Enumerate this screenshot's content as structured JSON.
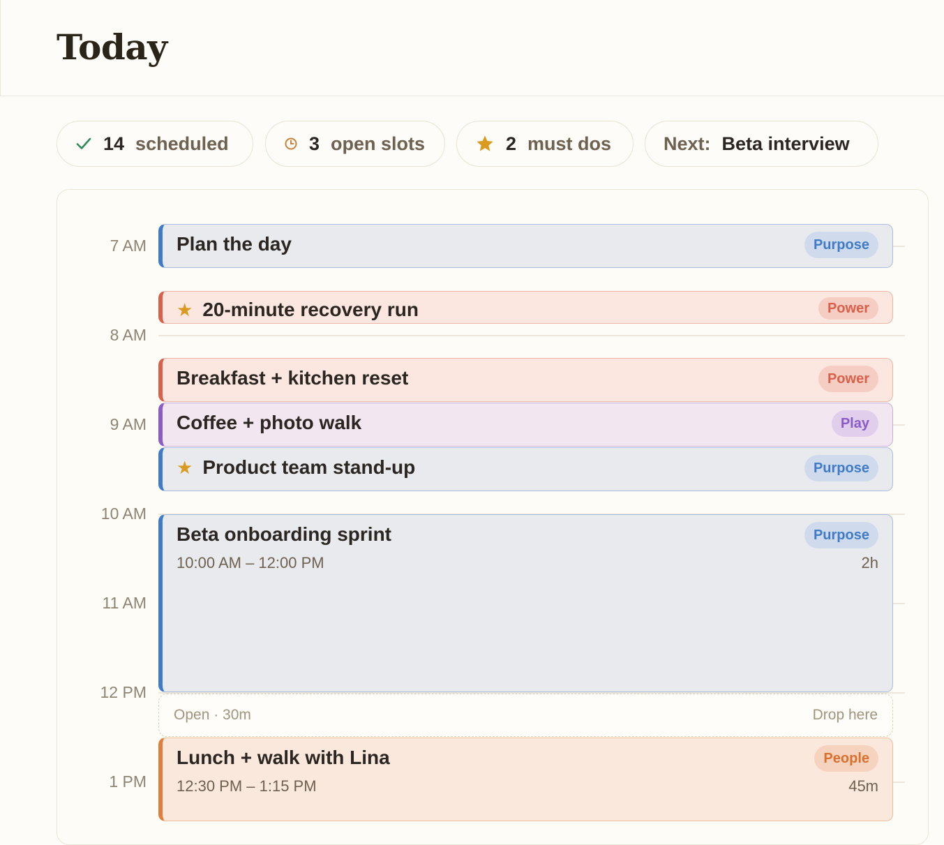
{
  "page": {
    "title": "Today"
  },
  "stats": {
    "scheduled": {
      "count": "14",
      "label": "scheduled",
      "icon": "check-icon"
    },
    "open": {
      "count": "3",
      "label": "open slots",
      "icon": "clock-icon"
    },
    "must": {
      "count": "2",
      "label": "must dos",
      "icon": "star-icon"
    },
    "next": {
      "label": "Next:",
      "value": "Beta interview"
    }
  },
  "hours": [
    "7 AM",
    "8 AM",
    "9 AM",
    "10 AM",
    "11 AM",
    "12 PM",
    "1 PM"
  ],
  "events": [
    {
      "title": "Plan the day",
      "tag": "Purpose",
      "category": "purpose",
      "star": false
    },
    {
      "title": "20-minute recovery run",
      "tag": "Power",
      "category": "power",
      "star": true
    },
    {
      "title": "Breakfast + kitchen reset",
      "tag": "Power",
      "category": "power",
      "star": false
    },
    {
      "title": "Coffee + photo walk",
      "tag": "Play",
      "category": "play",
      "star": false
    },
    {
      "title": "Product team stand-up",
      "tag": "Purpose",
      "category": "purpose",
      "star": true
    },
    {
      "title": "Beta onboarding sprint",
      "tag": "Purpose",
      "category": "purpose",
      "star": false,
      "time": "10:00 AM – 12:00 PM",
      "duration": "2h"
    },
    {
      "title": "Lunch + walk with Lina",
      "tag": "People",
      "category": "people",
      "star": false,
      "time": "12:30 PM – 1:15 PM",
      "duration": "45m"
    }
  ],
  "open_slot": {
    "label": "Open · 30m",
    "hint": "Drop here"
  },
  "colors": {
    "purpose": "#3f7bc7",
    "power": "#d9604a",
    "play": "#8a5cc7",
    "people": "#e07e3e",
    "star": "#d99a1f",
    "check": "#2e8b57"
  }
}
